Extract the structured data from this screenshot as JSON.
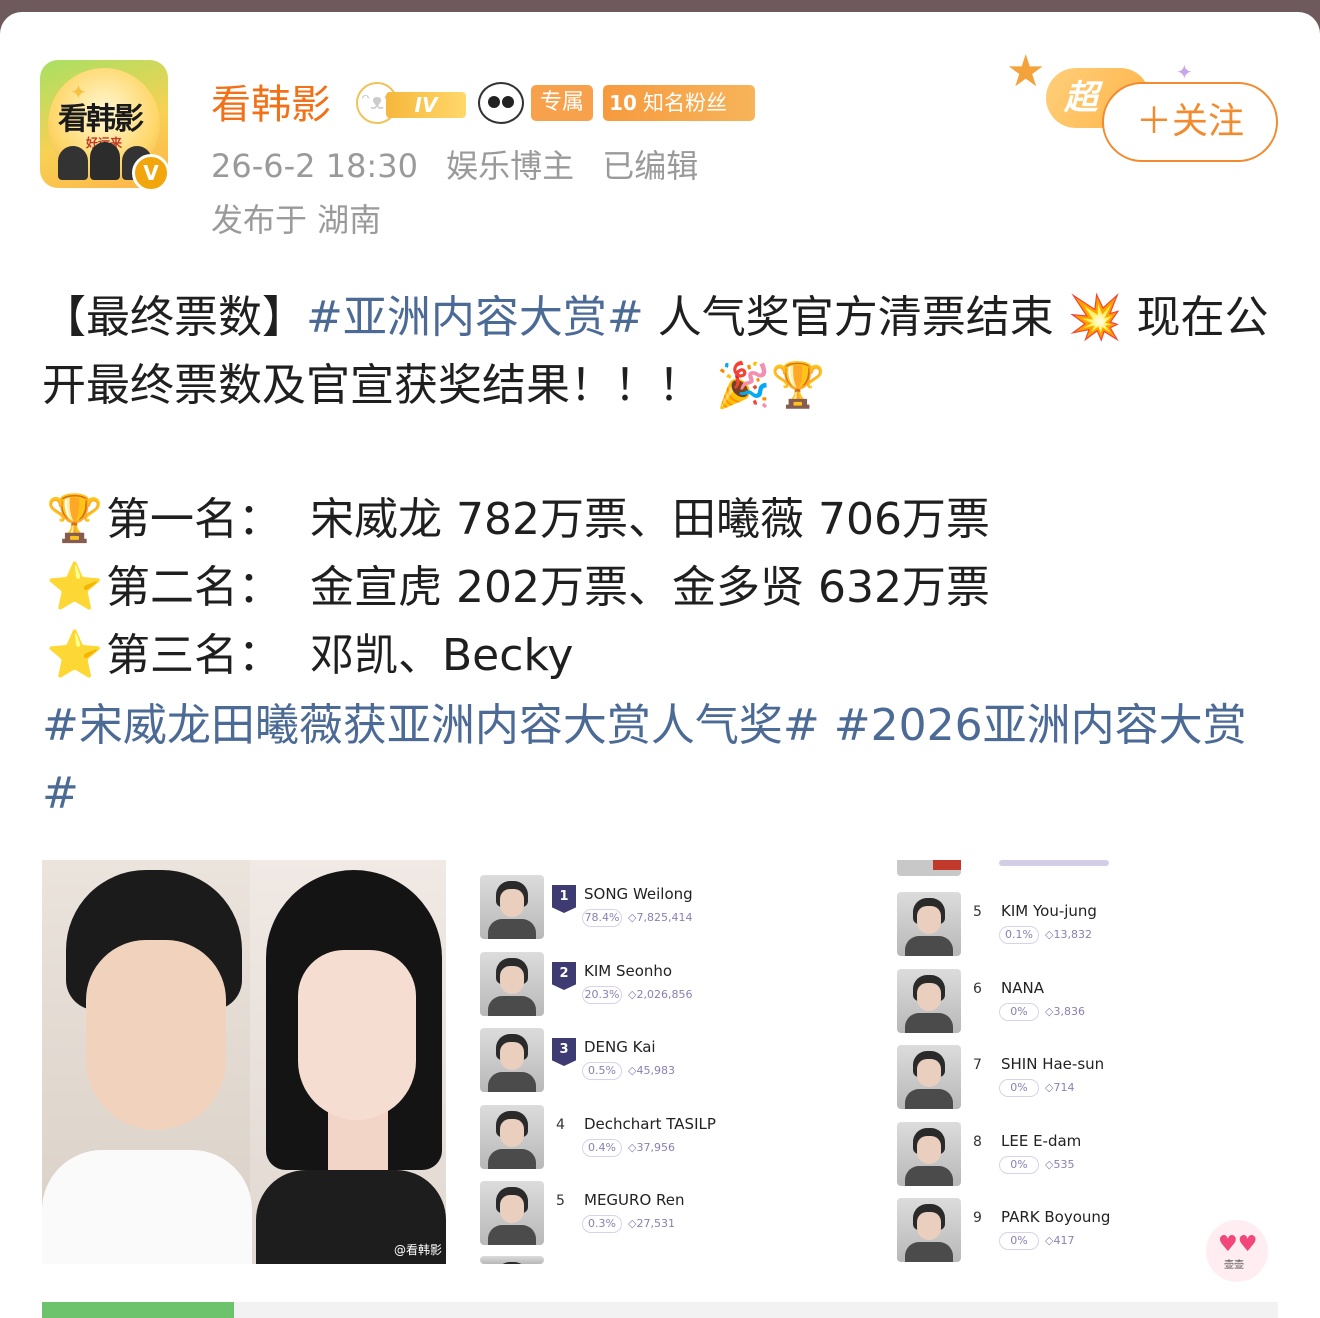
{
  "post": {
    "author": {
      "name": "看韩影",
      "avatar_text": "看韩影",
      "avatar_subtext": "好运来",
      "verified_mark": "V",
      "level_badge": "IV",
      "exclusive_badge": "专属",
      "fan_level": "10",
      "fan_badge": "知名粉丝"
    },
    "meta": {
      "time": "26-6-2 18:30",
      "role": "娱乐博主",
      "edited": "已编辑",
      "location": "发布于 湖南"
    },
    "super_label": "超",
    "follow_button": "＋关注",
    "text": {
      "prefix": "【最终票数】",
      "hashtag_award": "#亚洲内容大赏#",
      "line1_rest": " 人气奖官方清票结束 💥 现在公开最终票数及官宣获奖结果！！！ 🎉🏆"
    },
    "rankings": [
      {
        "icon": "🏆",
        "place": "第一名：",
        "names": "宋威龙 782万票、田曦薇 706万票"
      },
      {
        "icon": "⭐",
        "place": "第二名：",
        "names": "金宣虎 202万票、金多贤 632万票"
      },
      {
        "icon": "⭐",
        "place": "第三名：",
        "names": "邓凯、Becky"
      }
    ],
    "hashtags": "#宋威龙田曦薇获亚洲内容大赏人气奖# #2026亚洲内容大赏#",
    "images": {
      "photo_watermark": "@看韩影",
      "list_left": [
        {
          "rank": "1",
          "name": "SONG Weilong",
          "pct": "78.4%",
          "votes": "7,825,414"
        },
        {
          "rank": "2",
          "name": "KIM Seonho",
          "pct": "20.3%",
          "votes": "2,026,856"
        },
        {
          "rank": "3",
          "name": "DENG Kai",
          "pct": "0.5%",
          "votes": "45,983"
        },
        {
          "rank": "4",
          "name": "Dechchart TASILP",
          "pct": "0.4%",
          "votes": "37,956"
        },
        {
          "rank": "5",
          "name": "MEGURO Ren",
          "pct": "0.3%",
          "votes": "27,531"
        }
      ],
      "list_right": [
        {
          "rank": "5",
          "name": "KIM You-jung",
          "pct": "0.1%",
          "votes": "13,832"
        },
        {
          "rank": "6",
          "name": "NANA",
          "pct": "0%",
          "votes": "3,836"
        },
        {
          "rank": "7",
          "name": "SHIN Hae-sun",
          "pct": "0%",
          "votes": "714"
        },
        {
          "rank": "8",
          "name": "LEE E-dam",
          "pct": "0%",
          "votes": "535"
        },
        {
          "rank": "9",
          "name": "PARK Boyoung",
          "pct": "0%",
          "votes": "417"
        }
      ]
    },
    "float_button_text": "壶壶"
  }
}
